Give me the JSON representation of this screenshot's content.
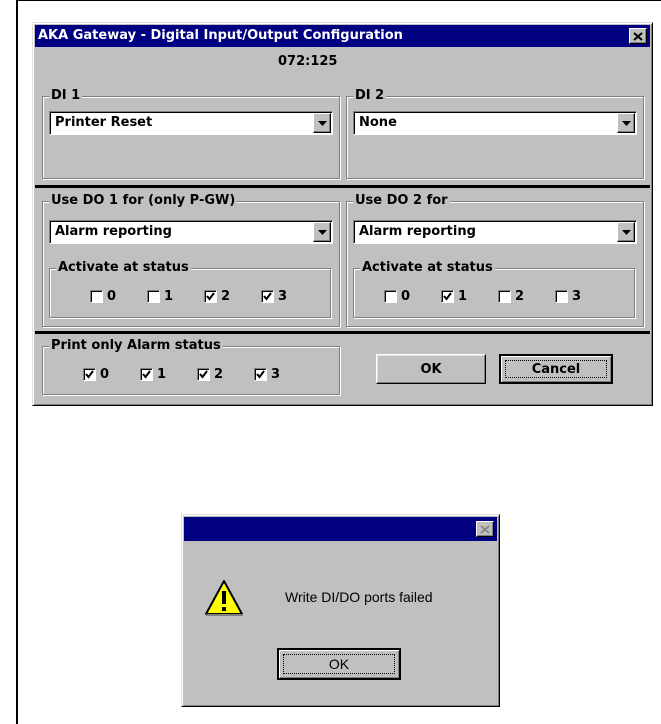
{
  "config_dialog": {
    "title": "AKA Gateway - Digital Input/Output Configuration",
    "address": "072:125",
    "di1": {
      "label": "DI 1",
      "value": "Printer Reset"
    },
    "di2": {
      "label": "DI 2",
      "value": "None"
    },
    "do1": {
      "label": "Use DO 1 for (only P-GW)",
      "value": "Alarm reporting",
      "activate_label": "Activate at status",
      "statuses": [
        {
          "label": "0",
          "checked": false
        },
        {
          "label": "1",
          "checked": false
        },
        {
          "label": "2",
          "checked": true
        },
        {
          "label": "3",
          "checked": true
        }
      ]
    },
    "do2": {
      "label": "Use DO 2 for",
      "value": "Alarm reporting",
      "activate_label": "Activate at status",
      "statuses": [
        {
          "label": "0",
          "checked": false
        },
        {
          "label": "1",
          "checked": true
        },
        {
          "label": "2",
          "checked": false
        },
        {
          "label": "3",
          "checked": false
        }
      ]
    },
    "print_only": {
      "label": "Print only Alarm status",
      "statuses": [
        {
          "label": "0",
          "checked": true
        },
        {
          "label": "1",
          "checked": true
        },
        {
          "label": "2",
          "checked": true
        },
        {
          "label": "3",
          "checked": true
        }
      ]
    },
    "ok_label": "OK",
    "cancel_label": "Cancel"
  },
  "message_box": {
    "title": "",
    "icon": "warning-icon",
    "message": "Write DI/DO ports failed",
    "ok_label": "OK"
  },
  "colors": {
    "title_bar": "#000080",
    "face": "#c0c0c0",
    "warning": "#ffff00"
  }
}
